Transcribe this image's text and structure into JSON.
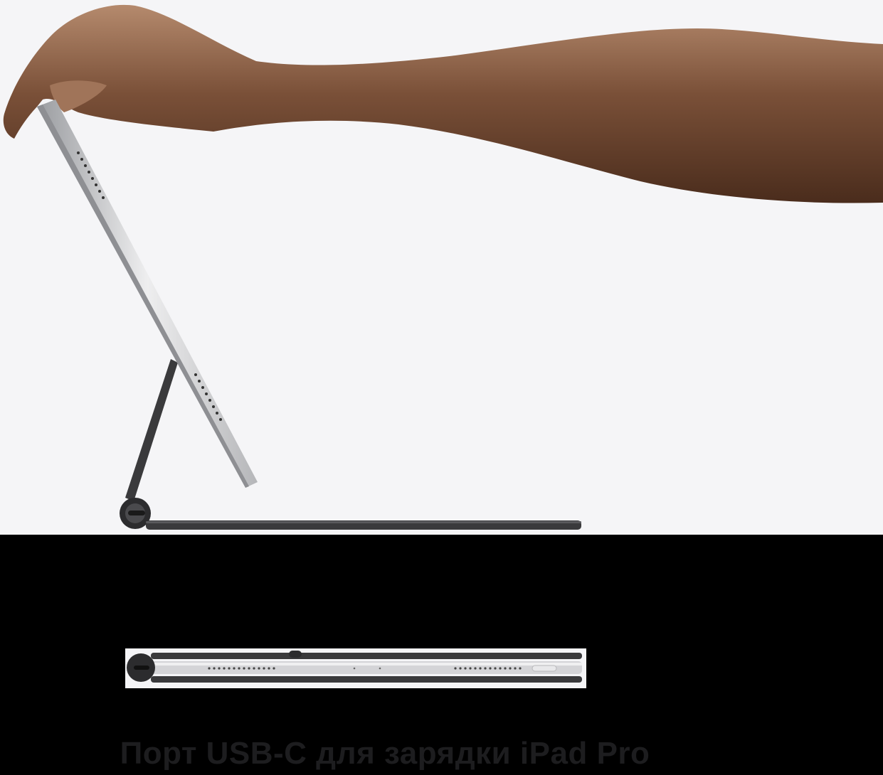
{
  "caption": {
    "text": "Порт USB-C для зарядки iPad Pro"
  },
  "colors": {
    "hero_background": "#f5f5f7",
    "page_background": "#000000",
    "caption_text": "#1d1d1f",
    "skin": "#8a5f45",
    "keyboard": "#3a3a3c",
    "aluminium": "#d9d9dc"
  }
}
